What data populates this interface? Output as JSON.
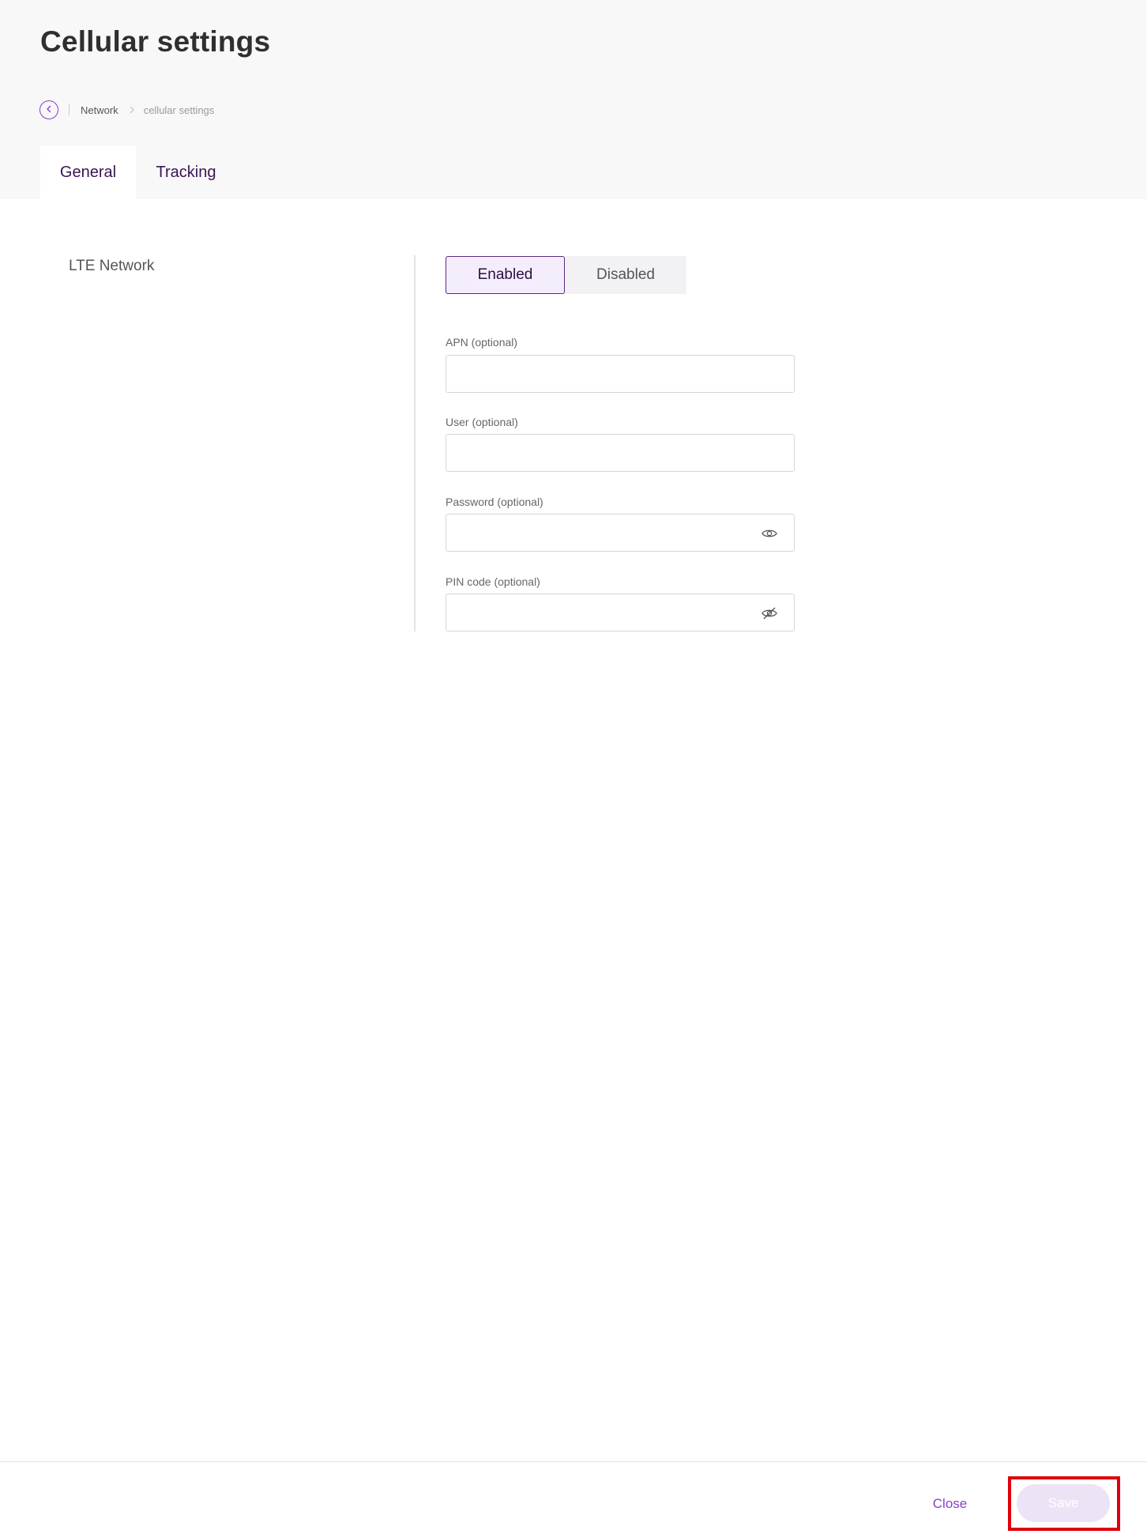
{
  "page": {
    "title": "Cellular settings"
  },
  "breadcrumb": {
    "items": [
      "Network",
      "cellular settings"
    ]
  },
  "tabs": [
    {
      "label": "General",
      "active": true
    },
    {
      "label": "Tracking",
      "active": false
    }
  ],
  "section": {
    "label": "LTE Network"
  },
  "toggle": {
    "enabled_label": "Enabled",
    "disabled_label": "Disabled",
    "selected": "Enabled"
  },
  "fields": {
    "apn": {
      "label": "APN (optional)",
      "value": ""
    },
    "user": {
      "label": "User (optional)",
      "value": ""
    },
    "password": {
      "label": "Password (optional)",
      "value": "",
      "icon": "eye-icon"
    },
    "pin": {
      "label": "PIN code (optional)",
      "value": "",
      "icon": "eye-off-icon"
    }
  },
  "footer": {
    "close_label": "Close",
    "save_label": "Save"
  },
  "colors": {
    "accent": "#8a3fc6",
    "toggle_border": "#5b2a83",
    "highlight": "#e0000b"
  }
}
